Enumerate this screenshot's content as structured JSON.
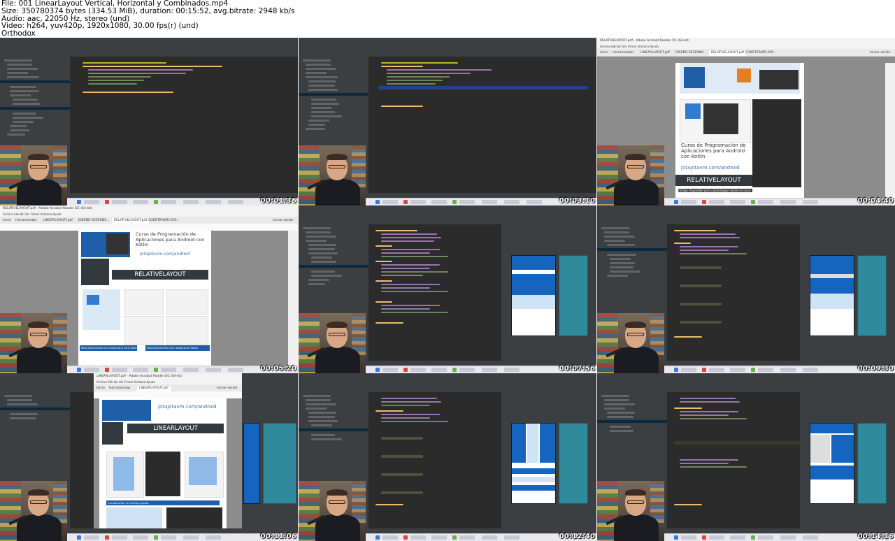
{
  "file_info": {
    "line1": "File: 001 LinearLayout Vertical, Horizontal y Combinados.mp4",
    "line2": "Size: 350780374 bytes (334.53 MiB), duration: 00:15:52, avg.bitrate: 2948 kb/s",
    "line3": "Audio: aac, 22050 Hz, stereo (und)",
    "line4": "Video: h264, yuv420p, 1920x1080, 30.00 fps(r) (und)",
    "line5": "Orthodox"
  },
  "thumbnails": [
    {
      "timestamp": "00:01:36",
      "kind": "ide"
    },
    {
      "timestamp": "00:03:10",
      "kind": "ide"
    },
    {
      "timestamp": "00:04:40",
      "kind": "pdf"
    },
    {
      "timestamp": "00:05:20",
      "kind": "pdf-full"
    },
    {
      "timestamp": "00:07:56",
      "kind": "ide-preview"
    },
    {
      "timestamp": "00:09:30",
      "kind": "ide-preview"
    },
    {
      "timestamp": "00:11:06",
      "kind": "pdf-ide"
    },
    {
      "timestamp": "00:12:40",
      "kind": "ide-preview"
    },
    {
      "timestamp": "00:14:16",
      "kind": "ide-preview"
    }
  ],
  "pdf": {
    "course_title": "Curso de Programación de Aplicaciones para Android con Kotlin",
    "link": "jotajotavm.com/android",
    "relative_banner": "RELATIVELAYOUT",
    "linear_banner": "LINEARLAYOUT",
    "file_name": "RELATIVELAYOUT.pdf - Adobe Acrobat Reader DC (64-bit)",
    "linear_file_name": "LINEARLAYOUT.pdf - Adobe Acrobat Reader DC (64-bit)",
    "menu": "Archivo  Edición  Ver  Firmar  Ventana  Ayuda",
    "tab_home": "Inicio",
    "tab_tools": "Herramientas",
    "tab_doc1": "LINEARLAYOUT.pdf",
    "tab_doc2": "DISEÑO RESPONS...",
    "tab_doc3": "RELATIVELAYOUT.pdf",
    "tab_doc4": "CONSTRAINTLAYO...",
    "login": "Iniciar sesión",
    "caption": "Código disponible para copiar/pegar desde el curso",
    "positioning_sibling": "Posicionamiento con respecto a otro View",
    "positioning_parent": "Posicionamiento con respecto al Padre",
    "linear_combo": "Combinación de LinearLayouts"
  },
  "colors": {
    "ide_bg": "#2b2b2b",
    "ide_panel": "#3c3f41",
    "phone_blue": "#1565c0",
    "phone_light": "#cfe3f7",
    "blueprint": "#2f8a9c",
    "pdf_banner": "#333a3f",
    "link_blue": "#2a6fb0"
  }
}
